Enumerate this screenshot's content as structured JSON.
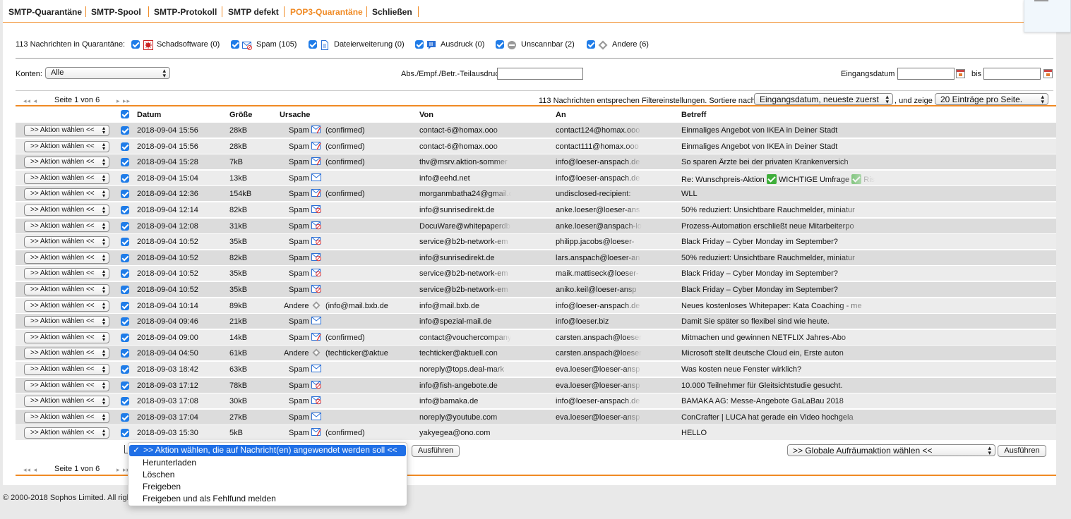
{
  "tabs": [
    {
      "label": "SMTP-Quarantäne",
      "active": false
    },
    {
      "label": "SMTP-Spool",
      "active": false
    },
    {
      "label": "SMTP-Protokoll",
      "active": false
    },
    {
      "label": "SMTP defekt",
      "active": false
    },
    {
      "label": "POP3-Quarantäne",
      "active": true
    },
    {
      "label": "Schließen",
      "active": false
    }
  ],
  "quarantine": {
    "summary": "113 Nachrichten in Quarantäne:",
    "categories": [
      {
        "label": "Schadsoftware (0)",
        "icon": "malware-icon"
      },
      {
        "label": "Spam (105)",
        "icon": "spam-mail-icon"
      },
      {
        "label": "Dateierweiterung (0)",
        "icon": "file-extension-icon"
      },
      {
        "label": "Ausdruck (0)",
        "icon": "expression-icon"
      },
      {
        "label": "Unscannbar (2)",
        "icon": "unscannable-icon"
      },
      {
        "label": "Andere (6)",
        "icon": "other-diamond-icon"
      }
    ]
  },
  "filters": {
    "accounts_label": "Konten:",
    "accounts_value": "Alle",
    "search_label": "Abs./Empf./Betr.-Teilausdruck:",
    "search_value": "",
    "date_label": "Eingangsdatum",
    "date_to_label": "bis",
    "date_from": "",
    "date_to": ""
  },
  "pager": {
    "top_page_text": "Seite 1 von 6",
    "bottom_page_text": "Seite 1 von 6",
    "match_text": "113 Nachrichten entsprechen Filtereinstellungen. Sortiere nach",
    "sort_value": "Eingangsdatum, neueste zuerst",
    "show_label": ", und zeige",
    "per_page_value": "20 Einträge pro Seite.",
    "first_prev": "◂◂ ◂",
    "next_last": "▸ ▸▸"
  },
  "table": {
    "headers": {
      "date": "Datum",
      "size": "Größe",
      "reason": "Ursache",
      "from": "Von",
      "to": "An",
      "subject": "Betreff"
    },
    "action_label": ">> Aktion wählen <<",
    "rows": [
      {
        "date": "2018-09-04 15:56",
        "size": "28kB",
        "reason": "Spam",
        "reason_icon": "spam-confirmed",
        "reason_extra": "(confirmed)",
        "from": "contact-6@homax.ooo",
        "to": "contact124@homax.ooo",
        "subject": "Einmaliges Angebot von IKEA in Deiner Stadt"
      },
      {
        "date": "2018-09-04 15:56",
        "size": "28kB",
        "reason": "Spam",
        "reason_icon": "spam-confirmed",
        "reason_extra": "(confirmed)",
        "from": "contact-6@homax.ooo",
        "to": "contact111@homax.ooo",
        "subject": "Einmaliges Angebot von IKEA in Deiner Stadt"
      },
      {
        "date": "2018-09-04 15:28",
        "size": "7kB",
        "reason": "Spam",
        "reason_icon": "spam-confirmed",
        "reason_extra": "(confirmed)",
        "from": "thv@msrv.aktion-sommer",
        "to": "info@loeser-anspach.de",
        "subject": "So sparen Ärzte bei der privaten Krankenversich"
      },
      {
        "date": "2018-09-04 15:04",
        "size": "13kB",
        "reason": "Spam",
        "reason_icon": "spam",
        "reason_extra": "",
        "from": "info@eehd.net",
        "to": "info@loeser-anspach.de",
        "subject": "Re: Wunschpreis-Aktion ✅ WICHTIGE Umfrage ✅ Risi"
      },
      {
        "date": "2018-09-04 12:36",
        "size": "154kB",
        "reason": "Spam",
        "reason_icon": "spam-confirmed",
        "reason_extra": "(confirmed)",
        "from": "morganmbatha24@gmail.c",
        "to": "undisclosed-recipient:",
        "subject": "WLL"
      },
      {
        "date": "2018-09-04 12:14",
        "size": "82kB",
        "reason": "Spam",
        "reason_icon": "spam-red",
        "reason_extra": "",
        "from": "info@sunrisedirekt.de",
        "to": "anke.loeser@loeser-ans",
        "subject": "50% reduziert: Unsichtbare Rauchmelder, miniatur"
      },
      {
        "date": "2018-09-04 12:08",
        "size": "31kB",
        "reason": "Spam",
        "reason_icon": "spam-red",
        "reason_extra": "",
        "from": "DocuWare@whitepaperdb",
        "to": "anke.loeser@anspach-lo",
        "subject": "Prozess-Automation erschließt neue Mitarbeiterpo"
      },
      {
        "date": "2018-09-04 10:52",
        "size": "35kB",
        "reason": "Spam",
        "reason_icon": "spam-red",
        "reason_extra": "",
        "from": "service@b2b-network-em",
        "to": "philipp.jacobs@loeser-",
        "subject": "Black Friday – Cyber Monday im September?"
      },
      {
        "date": "2018-09-04 10:52",
        "size": "82kB",
        "reason": "Spam",
        "reason_icon": "spam-red",
        "reason_extra": "",
        "from": "info@sunrisedirekt.de",
        "to": "lars.anspach@loeser-an",
        "subject": "50% reduziert: Unsichtbare Rauchmelder, miniatur"
      },
      {
        "date": "2018-09-04 10:52",
        "size": "35kB",
        "reason": "Spam",
        "reason_icon": "spam-red",
        "reason_extra": "",
        "from": "service@b2b-network-em",
        "to": "maik.mattiseck@loeser-",
        "subject": "Black Friday – Cyber Monday im September?"
      },
      {
        "date": "2018-09-04 10:52",
        "size": "35kB",
        "reason": "Spam",
        "reason_icon": "spam-red",
        "reason_extra": "",
        "from": "service@b2b-network-em",
        "to": "aniko.keil@loeser-ansp",
        "subject": "Black Friday – Cyber Monday im September?"
      },
      {
        "date": "2018-09-04 10:14",
        "size": "89kB",
        "reason": "Andere",
        "reason_icon": "other",
        "reason_extra": "(info@mail.bxb.de",
        "from": "info@mail.bxb.de",
        "to": "info@loeser-anspach.de",
        "subject": "Neues kostenloses Whitepaper: Kata Coaching - me"
      },
      {
        "date": "2018-09-04 09:46",
        "size": "21kB",
        "reason": "Spam",
        "reason_icon": "spam",
        "reason_extra": "",
        "from": "info@spezial-mail.de",
        "to": "info@loeser.biz",
        "subject": "Damit Sie später so flexibel sind wie heute."
      },
      {
        "date": "2018-09-04 09:00",
        "size": "14kB",
        "reason": "Spam",
        "reason_icon": "spam-confirmed",
        "reason_extra": "(confirmed)",
        "from": "contact@vouchercompany",
        "to": "carsten.anspach@loeser",
        "subject": "Mitmachen und gewinnen NETFLIX Jahres-Abo"
      },
      {
        "date": "2018-09-04 04:50",
        "size": "61kB",
        "reason": "Andere",
        "reason_icon": "other",
        "reason_extra": "(techticker@aktue",
        "from": "techticker@aktuell.con",
        "to": "carsten.anspach@loeser",
        "subject": "Microsoft stellt deutsche Cloud ein, Erste auton"
      },
      {
        "date": "2018-09-03 18:42",
        "size": "63kB",
        "reason": "Spam",
        "reason_icon": "spam",
        "reason_extra": "",
        "from": "noreply@tops.deal-mark",
        "to": "eva.loeser@loeser-ansp",
        "subject": "Was kosten neue Fenster wirklich?"
      },
      {
        "date": "2018-09-03 17:12",
        "size": "78kB",
        "reason": "Spam",
        "reason_icon": "spam-red",
        "reason_extra": "",
        "from": "info@fish-angebote.de",
        "to": "eva.loeser@loeser-ansp",
        "subject": "10.000 Teilnehmer für Gleitsichtstudie gesucht."
      },
      {
        "date": "2018-09-03 17:08",
        "size": "30kB",
        "reason": "Spam",
        "reason_icon": "spam-red",
        "reason_extra": "",
        "from": "info@bamaka.de",
        "to": "info@loeser-anspach.de",
        "subject": "BAMAKA AG: Messe-Angebote GaLaBau 2018"
      },
      {
        "date": "2018-09-03 17:04",
        "size": "27kB",
        "reason": "Spam",
        "reason_icon": "spam",
        "reason_extra": "",
        "from": "noreply@youtube.com",
        "to": "eva.loeser@loeser-ansp",
        "subject": "ConCrafter | LUCA hat gerade ein Video hochgela"
      },
      {
        "date": "2018-09-03 15:30",
        "size": "5kB",
        "reason": "Spam",
        "reason_icon": "spam-confirmed",
        "reason_extra": "(confirmed)",
        "from": "yakyegea@ono.com",
        "to": "",
        "subject": "HELLO"
      }
    ]
  },
  "bottom": {
    "execute_label": "Ausführen",
    "global_action_value": ">> Globale Aufräumaktion wählen <<",
    "global_execute_label": "Ausführen"
  },
  "dropdown": {
    "options": [
      {
        "label": ">> Aktion wählen, die auf Nachricht(en) angewendet werden soll <<",
        "selected": true
      },
      {
        "label": "Herunterladen",
        "selected": false
      },
      {
        "label": "Löschen",
        "selected": false
      },
      {
        "label": "Freigeben",
        "selected": false
      },
      {
        "label": "Freigeben und als Fehlfund melden",
        "selected": false
      }
    ],
    "check_mark": "✓"
  },
  "footer": {
    "text": "© 2000-2018 Sophos Limited. All righ"
  },
  "colors": {
    "accent": "#f08a24",
    "checkbox": "#1f7ce8",
    "row_odd": "#dcdcdc",
    "row_even": "#ececec",
    "selected_option": "#1f6fe6"
  }
}
